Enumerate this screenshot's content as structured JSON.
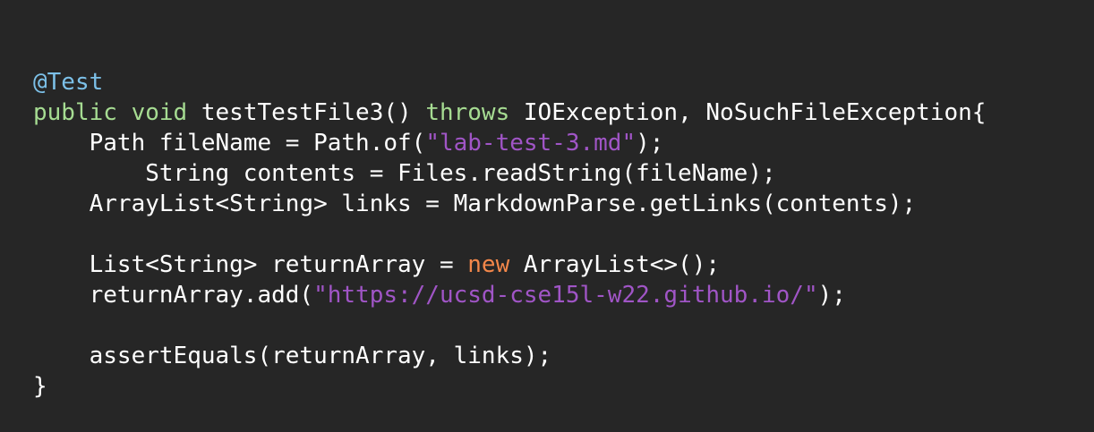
{
  "colors": {
    "background": "#262626",
    "plain": "#ffffff",
    "annotation": "#7cc0e8",
    "keyword": "#a6dc92",
    "new_keyword": "#f3874a",
    "string": "#a055c6"
  },
  "code": {
    "lines": [
      {
        "indent": "",
        "tokens": [
          {
            "kind": "annotation",
            "text": "@Test"
          }
        ]
      },
      {
        "indent": "",
        "tokens": [
          {
            "kind": "keyword",
            "text": "public"
          },
          {
            "kind": "plain",
            "text": " "
          },
          {
            "kind": "keyword",
            "text": "void"
          },
          {
            "kind": "plain",
            "text": " testTestFile3() "
          },
          {
            "kind": "keyword",
            "text": "throws"
          },
          {
            "kind": "plain",
            "text": " IOException, NoSuchFileException{"
          }
        ]
      },
      {
        "indent": "    ",
        "tokens": [
          {
            "kind": "plain",
            "text": "Path fileName = Path.of("
          },
          {
            "kind": "string",
            "text": "\"lab-test-3.md\""
          },
          {
            "kind": "plain",
            "text": ");"
          }
        ]
      },
      {
        "indent": "        ",
        "tokens": [
          {
            "kind": "plain",
            "text": "String contents = Files.readString(fileName);"
          }
        ]
      },
      {
        "indent": "    ",
        "tokens": [
          {
            "kind": "plain",
            "text": "ArrayList<String> links = MarkdownParse.getLinks(contents);"
          }
        ]
      },
      {
        "indent": "",
        "tokens": []
      },
      {
        "indent": "    ",
        "tokens": [
          {
            "kind": "plain",
            "text": "List<String> returnArray = "
          },
          {
            "kind": "new",
            "text": "new"
          },
          {
            "kind": "plain",
            "text": " ArrayList<>();"
          }
        ]
      },
      {
        "indent": "    ",
        "tokens": [
          {
            "kind": "plain",
            "text": "returnArray.add("
          },
          {
            "kind": "string",
            "text": "\"https://ucsd-cse15l-w22.github.io/\""
          },
          {
            "kind": "plain",
            "text": ");"
          }
        ]
      },
      {
        "indent": "",
        "tokens": []
      },
      {
        "indent": "    ",
        "tokens": [
          {
            "kind": "plain",
            "text": "assertEquals(returnArray, links);"
          }
        ]
      },
      {
        "indent": "",
        "tokens": [
          {
            "kind": "plain",
            "text": "}"
          }
        ]
      }
    ]
  }
}
